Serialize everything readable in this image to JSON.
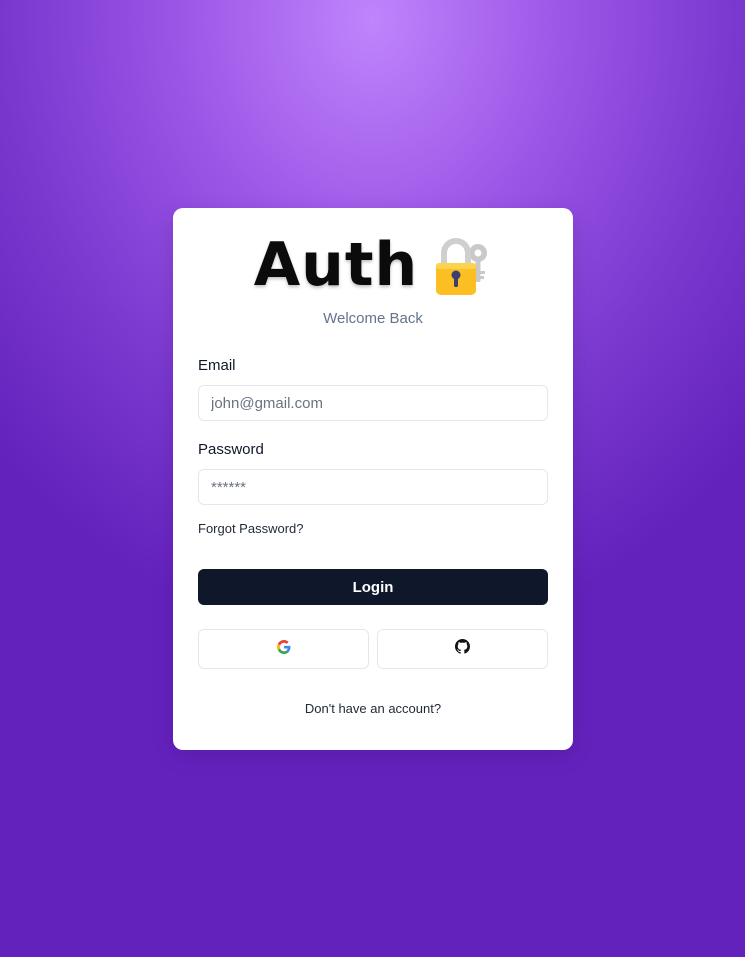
{
  "brand": {
    "title": "Auth",
    "icon": "lock-with-key-icon"
  },
  "subtitle": "Welcome Back",
  "form": {
    "email_label": "Email",
    "email_placeholder": "john@gmail.com",
    "password_label": "Password",
    "password_placeholder": "******",
    "forgot_password": "Forgot Password?",
    "login_label": "Login"
  },
  "social": {
    "google_icon": "google-icon",
    "github_icon": "github-icon"
  },
  "footer": {
    "signup_link": "Don't have an account?"
  },
  "colors": {
    "button_bg": "#0f172a",
    "lock_gold": "#fbbf24",
    "gradient_light": "#c084fc",
    "gradient_dark": "#6422bd"
  }
}
